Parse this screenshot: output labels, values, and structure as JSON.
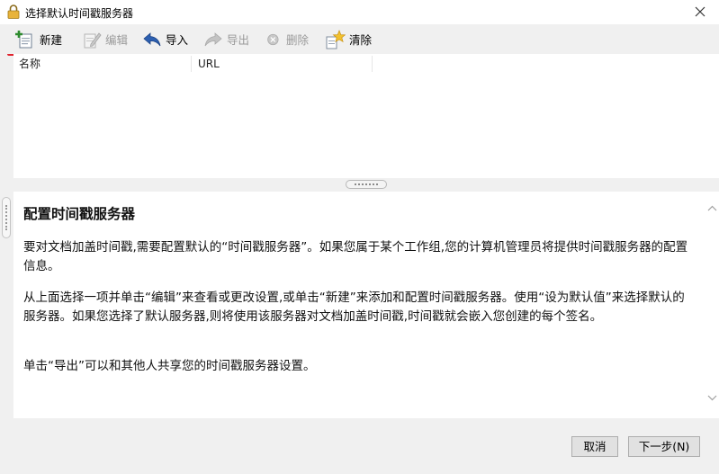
{
  "window": {
    "title": "选择默认时间戳服务器"
  },
  "toolbar": {
    "new_label": "新建",
    "edit_label": "编辑",
    "import_label": "导入",
    "export_label": "导出",
    "delete_label": "删除",
    "clear_label": "清除"
  },
  "list": {
    "columns": [
      "名称",
      "URL"
    ]
  },
  "description": {
    "heading": "配置时间戳服务器",
    "paragraphs": [
      "要对文档加盖时间戳,需要配置默认的“时间戳服务器”。如果您属于某个工作组,您的计算机管理员将提供时间戳服务器的配置信息。",
      "从上面选择一项并单击“编辑”来查看或更改设置,或单击“新建”来添加和配置时间戳服务器。使用“设为默认值”来选择默认的服务器。如果您选择了默认服务器,则将使用该服务器对文档加盖时间戳,时间戳就会嵌入您创建的每个签名。",
      "单击“导出”可以和其他人共享您的时间戳服务器设置。"
    ]
  },
  "footer": {
    "cancel_label": "取消",
    "next_label": "下一步(N)"
  },
  "colors": {
    "highlight_border": "#e0242f",
    "disabled_text": "#9a9a9a",
    "import_arrow": "#2c5fb0"
  }
}
